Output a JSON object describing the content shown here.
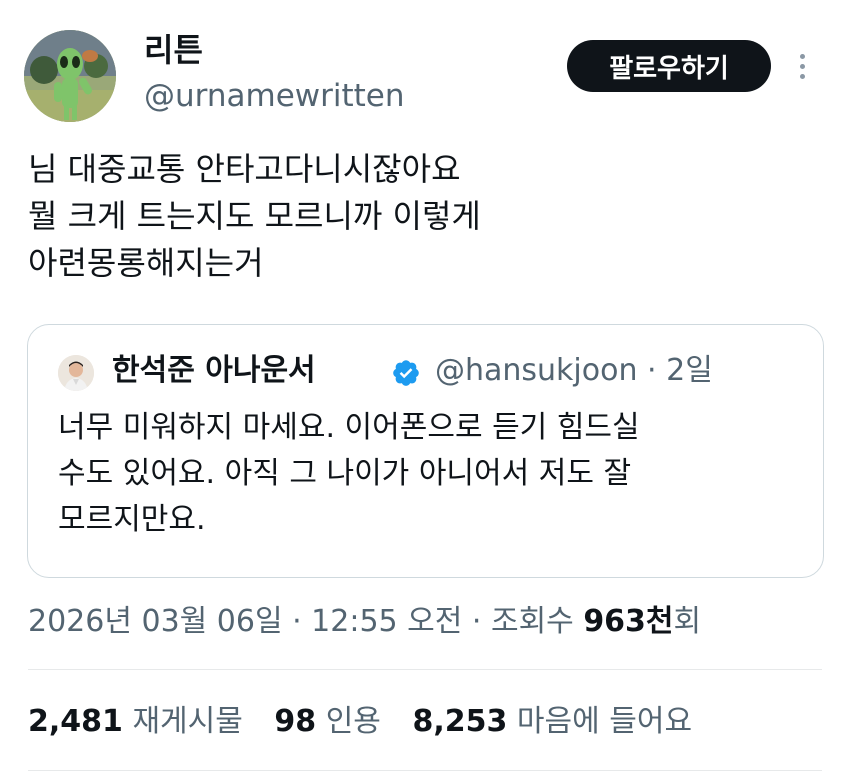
{
  "author": {
    "display_name": "리튼",
    "handle": "@urnamewritten"
  },
  "actions": {
    "follow_label": "팔로우하기"
  },
  "tweet": {
    "lines": [
      "님 대중교통 안타고다니시잖아요",
      "뭘 크게 트는지도 모르니까 이렇게",
      "아련몽롱해지는거"
    ]
  },
  "quote": {
    "display_name": "한석준 아나운서",
    "handle": "@hansukjoon",
    "separator": "·",
    "time": "2일",
    "lines": [
      "너무 미워하지 마세요. 이어폰으로 듣기 힘드실",
      "수도 있어요. 아직 그 나이가 아니어서 저도 잘",
      "모르지만요."
    ]
  },
  "meta": {
    "datetime": "2026년 03월 06일 · 12:55 오전 · 조회수 ",
    "views_number": "963천",
    "views_suffix": "회"
  },
  "stats": {
    "retweets_count": "2,481",
    "retweets_label": "재게시물",
    "quotes_count": "98",
    "quotes_label": "인용",
    "likes_count": "8,253",
    "likes_label": "마음에 들어요"
  },
  "colors": {
    "text": "#0f1419",
    "secondary": "#536471",
    "border": "#cfd9de",
    "verified": "#1d9bf0",
    "button_bg": "#0f1419"
  },
  "icons": {
    "verified": "verified-badge-icon",
    "more": "more-vertical-icon"
  }
}
